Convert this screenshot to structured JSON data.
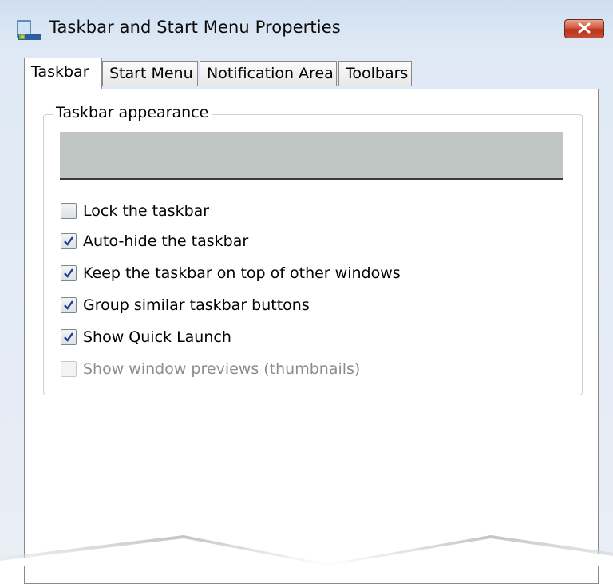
{
  "window": {
    "title": "Taskbar and Start Menu Properties",
    "close_icon": "close-x-icon"
  },
  "tabs": [
    {
      "label": "Taskbar",
      "active": true
    },
    {
      "label": "Start Menu",
      "active": false
    },
    {
      "label": "Notification Area",
      "active": false
    },
    {
      "label": "Toolbars",
      "active": false
    }
  ],
  "group": {
    "label": "Taskbar appearance"
  },
  "options": [
    {
      "label": "Lock the taskbar",
      "checked": false,
      "enabled": true
    },
    {
      "label": "Auto-hide the taskbar",
      "checked": true,
      "enabled": true
    },
    {
      "label": "Keep the taskbar on top of other windows",
      "checked": true,
      "enabled": true
    },
    {
      "label": "Group similar taskbar buttons",
      "checked": true,
      "enabled": true
    },
    {
      "label": "Show Quick Launch",
      "checked": true,
      "enabled": true
    },
    {
      "label": "Show window previews (thumbnails)",
      "checked": false,
      "enabled": false
    }
  ],
  "colors": {
    "close_button": "#c64c32",
    "checkmark": "#1f3f8f",
    "preview_fill": "#c0c6c3"
  }
}
